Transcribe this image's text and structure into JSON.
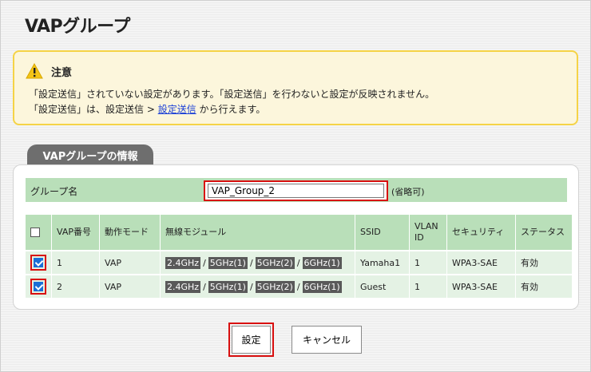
{
  "page": {
    "title": "VAPグループ"
  },
  "notice": {
    "title": "注意",
    "line1": "「設定送信」されていない設定があります。「設定送信」を行わないと設定が反映されません。",
    "line2_prefix": "「設定送信」は、設定送信 > ",
    "line2_link": "設定送信",
    "line2_suffix": " から行えます。"
  },
  "section": {
    "title": "VAPグループの情報"
  },
  "group": {
    "label": "グループ名",
    "value": "VAP_Group_2",
    "optional_note": "(省略可)"
  },
  "table": {
    "headers": [
      "VAP番号",
      "動作モード",
      "無線モジュール",
      "SSID",
      "VLAN ID",
      "セキュリティ",
      "ステータス"
    ],
    "rows": [
      {
        "checked": true,
        "vap_no": "1",
        "mode": "VAP",
        "modules": [
          "2.4GHz",
          "5GHz(1)",
          "5GHz(2)",
          "6GHz(1)"
        ],
        "ssid": "Yamaha1",
        "vlan": "1",
        "security": "WPA3-SAE",
        "status": "有効"
      },
      {
        "checked": true,
        "vap_no": "2",
        "mode": "VAP",
        "modules": [
          "2.4GHz",
          "5GHz(1)",
          "5GHz(2)",
          "6GHz(1)"
        ],
        "ssid": "Guest",
        "vlan": "1",
        "security": "WPA3-SAE",
        "status": "有効"
      }
    ]
  },
  "buttons": {
    "submit": "設定",
    "cancel": "キャンセル"
  },
  "colors": {
    "highlight": "#d80f0f",
    "header_green": "#b9dfb9",
    "notice_border": "#f5d346"
  }
}
